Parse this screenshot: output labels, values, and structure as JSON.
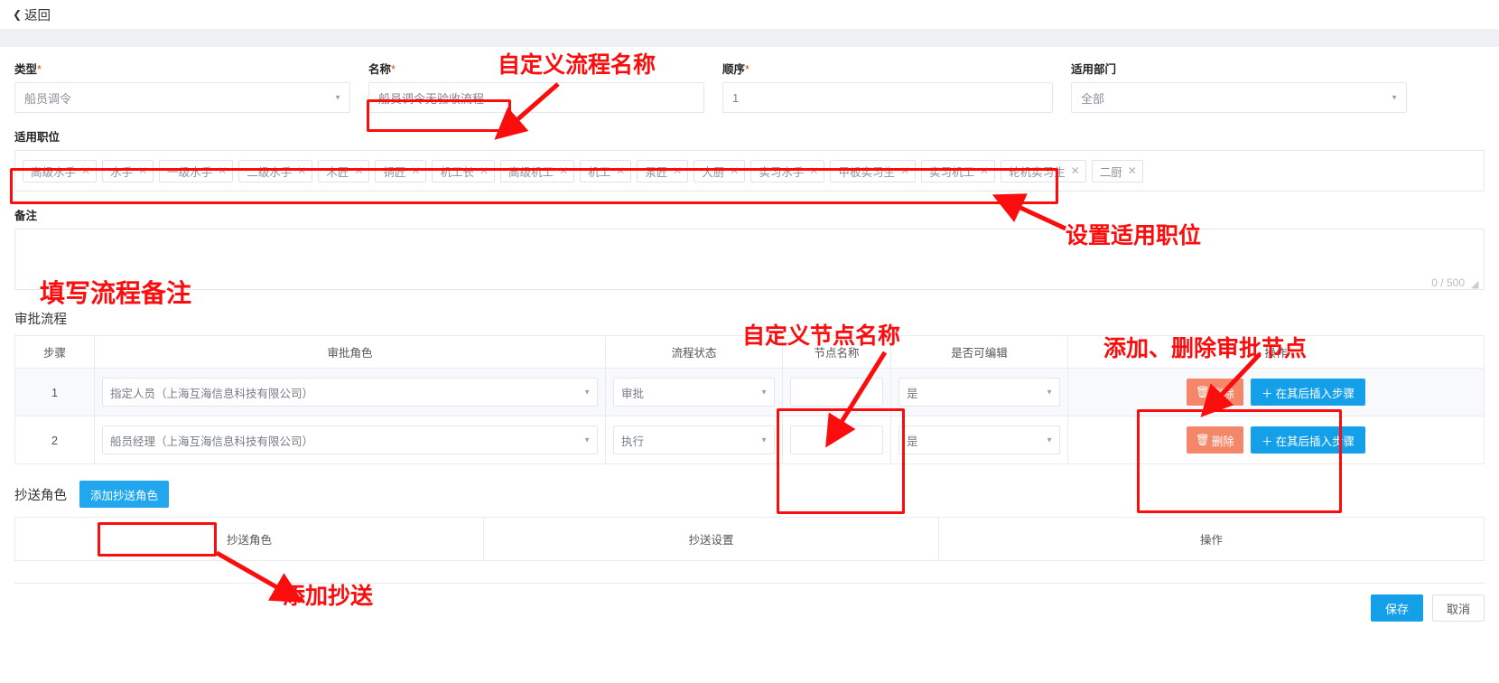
{
  "topbar": {
    "back_label": "返回",
    "back_icon": "chevron-left-icon"
  },
  "form": {
    "type": {
      "label": "类型",
      "required": true,
      "value": "船员调令",
      "caret_icon": "chevron-down-icon"
    },
    "name": {
      "label": "名称",
      "required": true,
      "value": "船员调令无验收流程"
    },
    "order": {
      "label": "顺序",
      "required": true,
      "value": "1"
    },
    "department": {
      "label": "适用部门",
      "required": false,
      "value": "全部",
      "caret_icon": "chevron-down-icon"
    },
    "positions": {
      "label": "适用职位",
      "tags": [
        "高级水手",
        "水手",
        "一级水手",
        "二级水手",
        "木匠",
        "铜匠",
        "机工长",
        "高级机工",
        "机工",
        "泵匠",
        "大厨",
        "实习水手",
        "甲板实习生",
        "实习机工",
        "轮机实习生",
        "二厨"
      ],
      "remove_icon": "close-icon"
    },
    "remark": {
      "label": "备注",
      "value": "",
      "placeholder": "",
      "counter": "0 / 500",
      "resize_icon": "resize-grip-icon"
    }
  },
  "approval": {
    "title": "审批流程",
    "columns": [
      "步骤",
      "审批角色",
      "流程状态",
      "节点名称",
      "是否可编辑",
      "操作"
    ],
    "rows": [
      {
        "step": "1",
        "role": "指定人员（上海互海信息科技有限公司）",
        "status": "审批",
        "node_name": "",
        "editable": "是",
        "delete_label": "删除",
        "insert_label": "在其后插入步骤",
        "delete_icon": "trash-icon",
        "insert_icon": "plus-icon",
        "caret_icon": "chevron-down-icon"
      },
      {
        "step": "2",
        "role": "船员经理（上海互海信息科技有限公司）",
        "status": "执行",
        "node_name": "",
        "editable": "是",
        "delete_label": "删除",
        "insert_label": "在其后插入步骤",
        "delete_icon": "trash-icon",
        "insert_icon": "plus-icon",
        "caret_icon": "chevron-down-icon"
      }
    ]
  },
  "cc": {
    "title": "抄送角色",
    "add_button": "添加抄送角色",
    "columns": [
      "抄送角色",
      "抄送设置",
      "操作"
    ]
  },
  "footer": {
    "save": "保存",
    "cancel": "取消"
  },
  "annotations": {
    "a1": "自定义流程名称",
    "a2": "设置适用职位",
    "a3": "填写流程备注",
    "a4": "自定义节点名称",
    "a5": "添加、删除审批节点",
    "a6": "添加抄送"
  },
  "colors": {
    "accent_blue": "#14a0e8",
    "danger": "#f4876a",
    "annotation_red": "#fb0d0d",
    "required_star": "#e8421c"
  }
}
